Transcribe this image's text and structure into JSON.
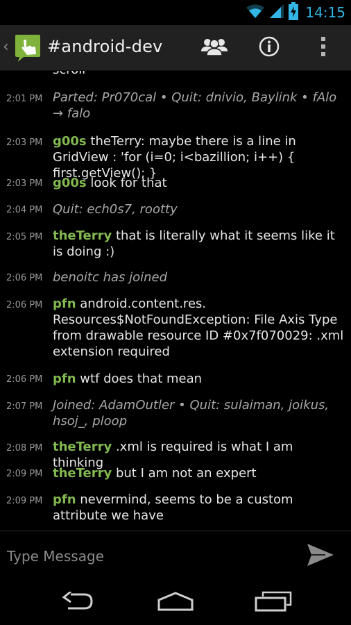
{
  "status_bar": {
    "time": "14:15",
    "icons": [
      "wifi-icon",
      "signal-icon",
      "battery-charging-icon"
    ]
  },
  "action_bar": {
    "title": "#android-dev",
    "icons": [
      "up-caret-icon",
      "app-logo-icon",
      "users-icon",
      "info-icon",
      "overflow-menu-icon"
    ],
    "accent_color": "#8bc34a"
  },
  "scroll_remnant": "scroll",
  "messages": [
    {
      "time": "2:01 PM",
      "kind": "event",
      "text": "Parted: Pr070cal • Quit: dnivio, Baylink • fAlo → falo"
    },
    {
      "time": "2:03 PM",
      "kind": "chat",
      "nick": "g00s",
      "text": "theTerry: maybe there is a line in GridView : 'for (i=0; i<bazillion; i++) { first.getView(); }"
    },
    {
      "time": "2:03 PM",
      "kind": "chat",
      "nick": "g00s",
      "text": "look for that"
    },
    {
      "time": "2:04 PM",
      "kind": "event",
      "text": "Quit: ech0s7, rootty"
    },
    {
      "time": "2:05 PM",
      "kind": "chat",
      "nick": "theTerry",
      "text": "that is literally what it seems like it is doing :)"
    },
    {
      "time": "2:06 PM",
      "kind": "event",
      "text": "benoitc has joined"
    },
    {
      "time": "2:06 PM",
      "kind": "chat",
      "nick": "pfn",
      "text": " android.content.res. Resources$NotFoundException: File Axis Type from drawable resource ID #0x7f070029: .xml extension required"
    },
    {
      "time": "2:06 PM",
      "kind": "chat",
      "nick": "pfn",
      "text": "wtf does that mean"
    },
    {
      "time": "2:07 PM",
      "kind": "event",
      "text": "Joined: AdamOutler • Quit: sulaiman, joikus, hsoj_, ploop"
    },
    {
      "time": "2:08 PM",
      "kind": "chat",
      "nick": "theTerry",
      "text": ".xml is required is what I am thinking"
    },
    {
      "time": "2:09 PM",
      "kind": "chat",
      "nick": "theTerry",
      "text": "but I am not an expert"
    },
    {
      "time": "2:09 PM",
      "kind": "chat",
      "nick": "pfn",
      "text": "nevermind, seems to be a custom attribute we have"
    }
  ],
  "input": {
    "placeholder": "Type Message",
    "value": "",
    "send_icon": "send-icon"
  },
  "nav_bar": {
    "icons": [
      "back-icon",
      "home-icon",
      "recent-apps-icon"
    ]
  },
  "colors": {
    "nick": "#82b850",
    "clock": "#33b5e5",
    "action_bar_bg": "#212121",
    "background": "#000000"
  }
}
